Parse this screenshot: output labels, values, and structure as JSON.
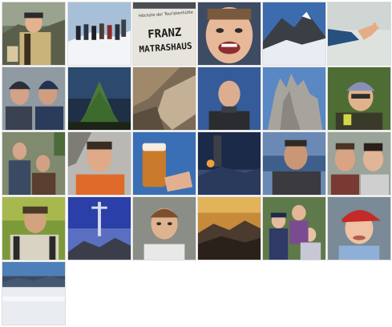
{
  "gallery": {
    "columns": 6,
    "thumbnails": [
      {
        "subject": "person-with-cap"
      },
      {
        "subject": "hikers-on-snow"
      },
      {
        "subject": "hut-sign",
        "sign_text_line1": "FRANZ",
        "sign_text_line2": "MATRASHAUS",
        "sign_small": "Höchste der Touristenhütte"
      },
      {
        "subject": "laughing-face"
      },
      {
        "subject": "snowy-peak"
      },
      {
        "subject": "hand-and-sky"
      },
      {
        "subject": "two-climbers-helmets"
      },
      {
        "subject": "pine-tree-night"
      },
      {
        "subject": "rock-slabs"
      },
      {
        "subject": "bald-man-portrait"
      },
      {
        "subject": "rock-towers"
      },
      {
        "subject": "man-with-bandana"
      },
      {
        "subject": "two-hikers-packs"
      },
      {
        "subject": "man-on-rocks"
      },
      {
        "subject": "beer-glass-toast"
      },
      {
        "subject": "summit-tower-night"
      },
      {
        "subject": "man-by-lake"
      },
      {
        "subject": "couple-smiling"
      },
      {
        "subject": "hiker-with-cap"
      },
      {
        "subject": "summit-cross-blue"
      },
      {
        "subject": "boy-portrait"
      },
      {
        "subject": "sunset-mountains"
      },
      {
        "subject": "children-group"
      },
      {
        "subject": "child-red-cap"
      },
      {
        "subject": "sea-of-fog"
      }
    ]
  }
}
